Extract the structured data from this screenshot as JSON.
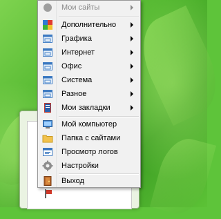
{
  "menu": {
    "header_item": {
      "label": "Мои сайты"
    },
    "categories": [
      {
        "label": "Дополнительно",
        "icon": "blocks-icon"
      },
      {
        "label": "Графика",
        "icon": "window-icon"
      },
      {
        "label": "Интернет",
        "icon": "window-icon"
      },
      {
        "label": "Офис",
        "icon": "window-icon"
      },
      {
        "label": "Система",
        "icon": "window-icon"
      },
      {
        "label": "Разное",
        "icon": "window-icon"
      },
      {
        "label": "Мои закладки",
        "icon": "bookmarks-icon"
      }
    ],
    "actions": [
      {
        "label": "Мой компьютер",
        "icon": "computer-icon"
      },
      {
        "label": "Папка с сайтами",
        "icon": "folder-icon"
      },
      {
        "label": "Просмотр логов",
        "icon": "log-icon"
      },
      {
        "label": "Настройки",
        "icon": "gear-icon"
      }
    ],
    "exit": {
      "label": "Выход",
      "icon": "door-icon"
    }
  },
  "colors": {
    "menu_bg": "#f1f1f1",
    "menu_border": "#979797",
    "disabled_text": "#8a8a8a",
    "desktop_green": "#4fb52d"
  }
}
